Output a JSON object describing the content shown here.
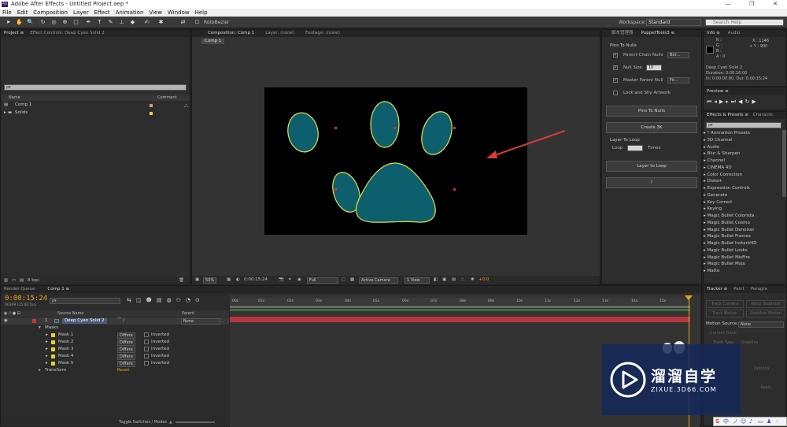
{
  "app": {
    "title": "Adobe After Effects - Untitled Project.aep *",
    "logo": "Ae"
  },
  "window_controls": [
    "—",
    "❐",
    "✕"
  ],
  "menu": [
    "File",
    "Edit",
    "Composition",
    "Layer",
    "Effect",
    "Animation",
    "View",
    "Window",
    "Help"
  ],
  "toolbar": {
    "roto_label": "RotoBezier",
    "workspace_label": "Workspace:",
    "workspace_value": "Standard",
    "search_placeholder": "Search Help"
  },
  "project": {
    "tabs": [
      "Project ≡",
      "Effect Controls: Deep Cyan Solid 2"
    ],
    "search_placeholder": "ρ▾",
    "col_name": "Name",
    "col_comment": "Comment",
    "items": [
      {
        "name": "Comp 1",
        "color": "#c9a36b"
      },
      {
        "name": "Solids",
        "color": "#e5d04a"
      }
    ],
    "bpc": "8 bpc"
  },
  "composition": {
    "tabs": [
      "Composition: Comp 1",
      "Layer: (none)",
      "Footage: (none)"
    ],
    "crumb": "Comp 1",
    "footer": {
      "zoom": "50%",
      "time": "0:00:15:24",
      "res": "Full",
      "camera": "Active Camera",
      "view": "1 View",
      "exposure": "+0.0"
    }
  },
  "scripts": {
    "tabs": [
      "脚本管理器",
      "PuppetTools3 ≡"
    ],
    "section_pins": "Pins To Nulls",
    "parent_chain": {
      "label": "Parent-Chain Nulls",
      "value": "Bot..."
    },
    "null_size": {
      "label": "Null Size",
      "value": "10"
    },
    "master_parent": {
      "label": "Master Parent Null",
      "value": "Fir..."
    },
    "lock_shy": "Lock and Shy Artwork",
    "pins_btn": "Pins To Nulls",
    "create_btn": "Create 3K",
    "section_loop": "Layer To Loop",
    "loop_label": "Loop",
    "times_label": "Times",
    "layer_loop_btn": "Layer to Loop",
    "help_btn": "?"
  },
  "info": {
    "tabs": [
      "Info ≡",
      "Audio"
    ],
    "r": "R :",
    "g": "G :",
    "b": "B :",
    "a": "A : 0",
    "x": "X : 1146",
    "y": "+ Y : 900",
    "layer": "Deep Cyan Solid 2",
    "duration": "Duration: 0:00:16:00",
    "inout": "In: 0:00:00:00, Out: 0:00:15:24"
  },
  "preview": {
    "tab": "Preview ≡"
  },
  "effects": {
    "tabs": [
      "Effects & Presets ≡",
      "Characte"
    ],
    "search": "ρ▾",
    "items": [
      "* Animation Presets",
      "3D Channel",
      "Audio",
      "Blur & Sharpen",
      "Channel",
      "CINEMA 4D",
      "Color Correction",
      "Distort",
      "Expression Controls",
      "Generate",
      "Key Correct",
      "Keying",
      "Magic Bullet Colorista",
      "Magic Bullet Cosmo",
      "Magic Bullet Denoiser",
      "Magic Bullet Frames",
      "Magic Bullet InstantHD",
      "Magic Bullet Looks",
      "Magic Bullet MisFire",
      "Magic Bullet Mojo",
      "Matte"
    ]
  },
  "timeline": {
    "tabs": [
      "Render Queue",
      "Comp 1 ≡"
    ],
    "timecode": "0:00:15:24",
    "fps": "00399 (25.00 fps)",
    "search": "ρ▾",
    "col_source": "Source Name",
    "col_parent": "Parent",
    "layer": {
      "num": "1",
      "name": "Deep Cyan Solid 2",
      "parent": "None"
    },
    "masks_label": "Masks",
    "masks": [
      {
        "name": "Mask 1",
        "mode": "Differe",
        "inv": "Inverted"
      },
      {
        "name": "Mask 2",
        "mode": "Differe",
        "inv": "Inverted"
      },
      {
        "name": "Mask 3",
        "mode": "Differe",
        "inv": "Inverted"
      },
      {
        "name": "Mask 4",
        "mode": "Differe",
        "inv": "Inverted"
      },
      {
        "name": "Mask 5",
        "mode": "Differe",
        "inv": "Inverted"
      }
    ],
    "transform": "Transform",
    "reset": "Reset",
    "toggle": "Toggle Switches / Modes",
    "ruler": [
      "00s",
      "01s",
      "02s",
      "03s",
      "04s",
      "05s",
      "06s",
      "07s",
      "08s",
      "09s",
      "10s",
      "11s",
      "12s",
      "13s",
      "14s",
      "15s"
    ]
  },
  "tracker": {
    "tabs": [
      "Tracker ≡",
      "Paint",
      "Paragra"
    ],
    "track_camera": "Track Camera",
    "warp": "Warp Stabilizer",
    "track_motion": "Track Motion",
    "stabilize": "Stabilize Motion",
    "source_label": "Motion Source:",
    "source_value": "None",
    "current_track": "Current Track:",
    "track_type": "Track Type:",
    "track_type_value": "Stabilize",
    "options": "Options...",
    "apply": "Apply"
  },
  "watermark": {
    "cn": "溜溜自学",
    "url": "ZIXUE.3D66.COM"
  },
  "colors": {
    "accent": "#e8a317",
    "cyan": "#0e5f6e",
    "mask_yellow": "#e4e23a",
    "layer_bar": "#b4363d",
    "arrow": "#d93a3a"
  }
}
